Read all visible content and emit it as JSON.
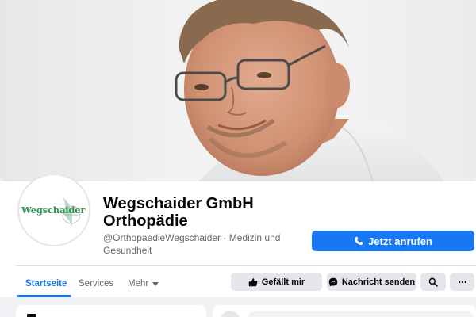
{
  "page": {
    "name_line1": "Wegschaider GmbH",
    "name_line2": "Orthopädie",
    "handle": "@OrthopaedieWegschaider · Medizin und Gesundheit",
    "avatar_logo_text": "Wegschaider"
  },
  "actions": {
    "call_label": "Jetzt anrufen",
    "like_label": "Gefällt mir",
    "message_label": "Nachricht senden"
  },
  "tabs": [
    {
      "label": "Startseite",
      "active": true
    },
    {
      "label": "Services",
      "active": false
    },
    {
      "label": "Mehr",
      "active": false
    }
  ],
  "icons": {
    "call": "phone-icon",
    "like": "thumbs-up-icon",
    "message": "messenger-icon",
    "search": "search-icon",
    "more": "more-options-icon",
    "dropdown": "caret-down-icon"
  },
  "colors": {
    "accent": "#1877f2",
    "button_grey": "#e4e6eb",
    "text_primary": "#050505",
    "text_secondary": "#65676b",
    "logo_green": "#2e9a54"
  }
}
